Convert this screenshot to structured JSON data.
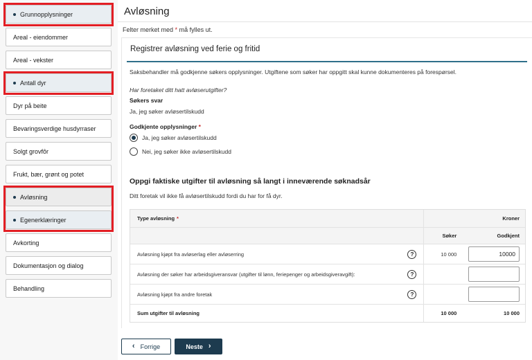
{
  "sidebar": {
    "items": [
      {
        "label": "Grunnopplysninger",
        "flagged": true
      },
      {
        "label": "Areal - eiendommer",
        "flagged": false
      },
      {
        "label": "Areal - vekster",
        "flagged": false
      },
      {
        "label": "Antall dyr",
        "flagged": true
      },
      {
        "label": "Dyr på beite",
        "flagged": false
      },
      {
        "label": "Bevaringsverdige husdyrraser",
        "flagged": false
      },
      {
        "label": "Solgt grovfôr",
        "flagged": false
      },
      {
        "label": "Frukt, bær, grønt og potet",
        "flagged": false
      },
      {
        "label": "Avløsning",
        "flagged": true
      },
      {
        "label": "Egenerklæringer",
        "flagged": true
      },
      {
        "label": "Avkorting",
        "flagged": false
      },
      {
        "label": "Dokumentasjon og dialog",
        "flagged": false
      },
      {
        "label": "Behandling",
        "flagged": false
      }
    ]
  },
  "page": {
    "title": "Avløsning",
    "required_note_prefix": "Felter merket med",
    "required_star": "*",
    "required_note_suffix": "må fylles ut."
  },
  "card": {
    "title": "Registrer avløsning ved ferie og fritid",
    "intro": "Saksbehandler må godkjenne søkers opplysninger. Utgiftene som søker har oppgitt skal kunne dokumenteres på forespørsel.",
    "question": "Har foretaket ditt hatt avløserutgifter?",
    "answer_label": "Søkers svar",
    "answer_value": "Ja, jeg søker avløsertilskudd",
    "approval_label": "Godkjente opplysninger",
    "required_star": "*",
    "options": [
      {
        "label": "Ja, jeg søker avløsertilskudd",
        "selected": true
      },
      {
        "label": "Nei, jeg søker ikke avløsertilskudd",
        "selected": false
      }
    ],
    "section_title": "Oppgi faktiske utgifter til avløsning så langt i inneværende søknadsår",
    "section_note": "Ditt foretak vil ikke få avløsertilskudd fordi du har for få dyr."
  },
  "table": {
    "col_type": "Type avløsning",
    "required_star": "*",
    "col_currency": "Kroner",
    "col_applicant": "Søker",
    "col_approved": "Godkjent",
    "rows": [
      {
        "label": "Avløsning kjøpt fra avløserlag eller avløserring",
        "applicant": "10 000",
        "approved": "10000"
      },
      {
        "label": "Avløsning der søker har arbeidsgiveransvar (utgifter til lønn, feriepenger og arbeidsgiveravgift):",
        "applicant": "",
        "approved": ""
      },
      {
        "label": "Avløsning kjøpt fra andre foretak",
        "applicant": "",
        "approved": ""
      }
    ],
    "sum_label": "Sum utgifter til avløsning",
    "sum_applicant": "10 000",
    "sum_approved": "10 000",
    "help_glyph": "?"
  },
  "buttons": {
    "prev_label": "Forrige",
    "next_label": "Neste"
  },
  "colors": {
    "brand": "#1d3b4f",
    "accent_rule": "#2f6f8a",
    "highlight": "#e31e24"
  }
}
